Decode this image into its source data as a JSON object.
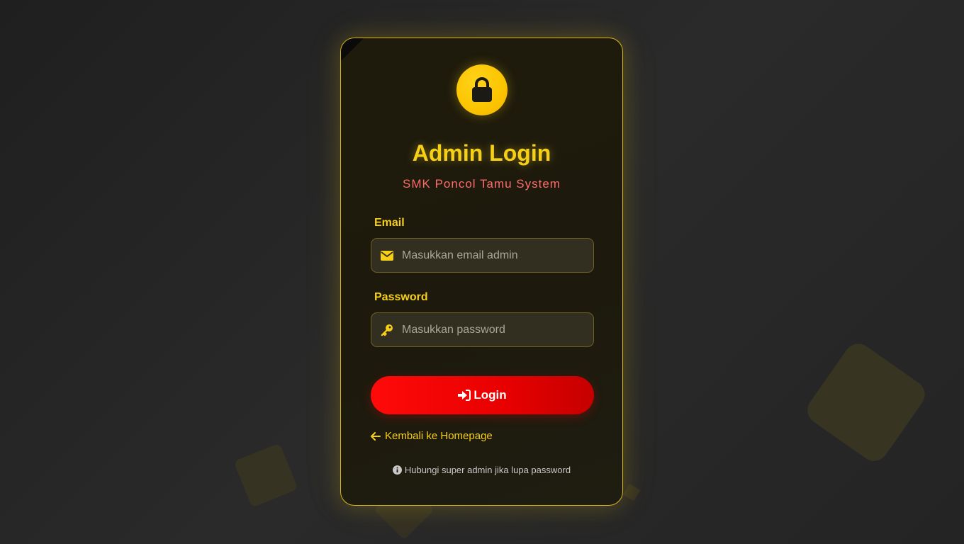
{
  "title": "Admin Login",
  "subtitle": "SMK Poncol Tamu System",
  "form": {
    "email": {
      "label": "Email",
      "placeholder": "Masukkan email admin",
      "value": "",
      "icon": "envelope-icon"
    },
    "password": {
      "label": "Password",
      "placeholder": "Masukkan password",
      "value": "",
      "icon": "key-icon"
    },
    "submit": {
      "label": "Login",
      "icon": "sign-in-icon"
    }
  },
  "back_link": {
    "label": "Kembali ke Homepage",
    "icon": "arrow-left-icon"
  },
  "help_note": {
    "text": "Hubungi super admin jika lupa password",
    "icon": "info-circle-icon"
  },
  "header_icon": "lock-icon",
  "colors": {
    "accent": "#f6cf17",
    "subtitle": "#ff6b6b",
    "button": "#ff0a0a",
    "card_border": "#d8b719",
    "background": "#242424"
  }
}
